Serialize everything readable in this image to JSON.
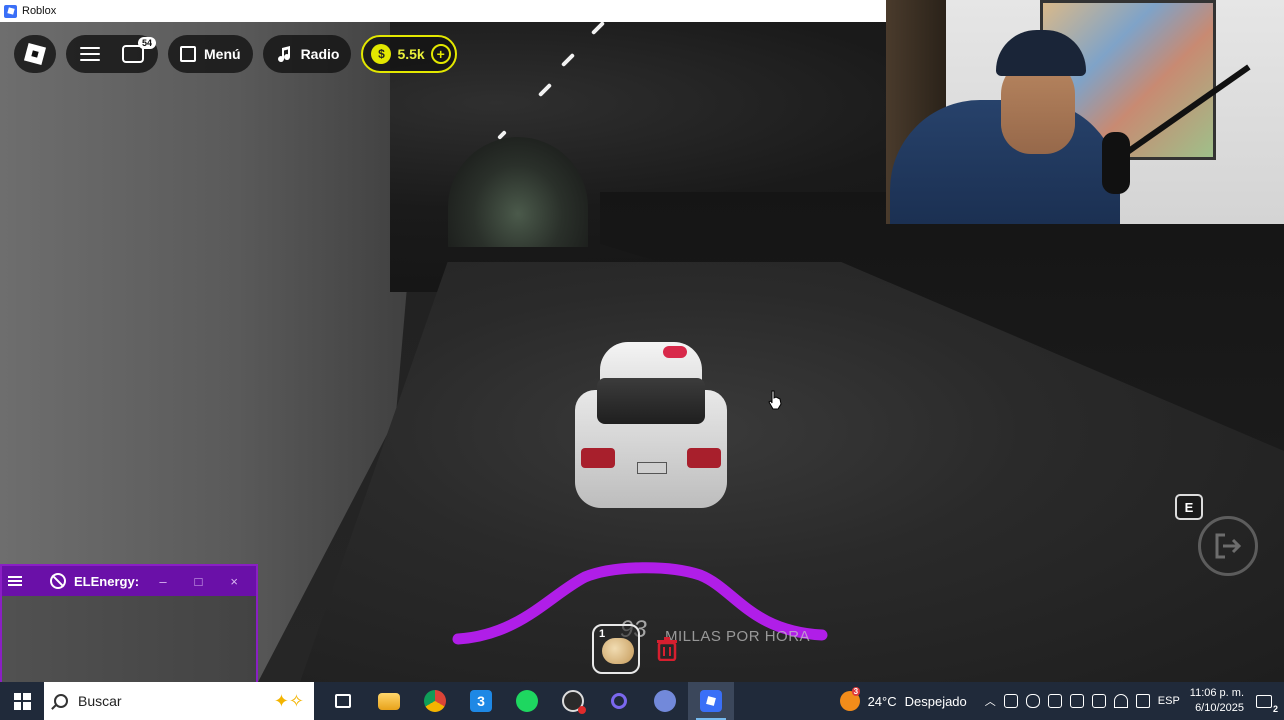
{
  "window": {
    "title": "Roblox"
  },
  "topbar": {
    "chat_badge": "54",
    "menu_label": "Menú",
    "radio_label": "Radio",
    "currency": "5.5k",
    "coin_symbol": "$",
    "plus_symbol": "+"
  },
  "script_window": {
    "title": "ELEnergy",
    "title_suffix": ":",
    "minimize": "–",
    "maximize": "□",
    "close": "×"
  },
  "hud": {
    "speed": "93",
    "speed_unit": "MILLAS POR HORA",
    "slot_number": "1",
    "interact_key": "E",
    "speed_arc_color": "#b01ee8"
  },
  "taskbar": {
    "search_placeholder": "Buscar",
    "apps": [
      "task-view",
      "file-explorer",
      "chrome",
      "three-app",
      "spotify",
      "obs",
      "cortana",
      "discord",
      "roblox"
    ],
    "weather_badge": "3",
    "temperature": "24°C",
    "weather": "Despejado",
    "language": "ESP",
    "time": "11:06 p. m.",
    "date": "6/10/2025",
    "notifications": "2"
  },
  "colors": {
    "accent_purple": "#6a10a8",
    "coin_yellow": "#e3e800",
    "taskbar_bg": "#202a3a"
  }
}
